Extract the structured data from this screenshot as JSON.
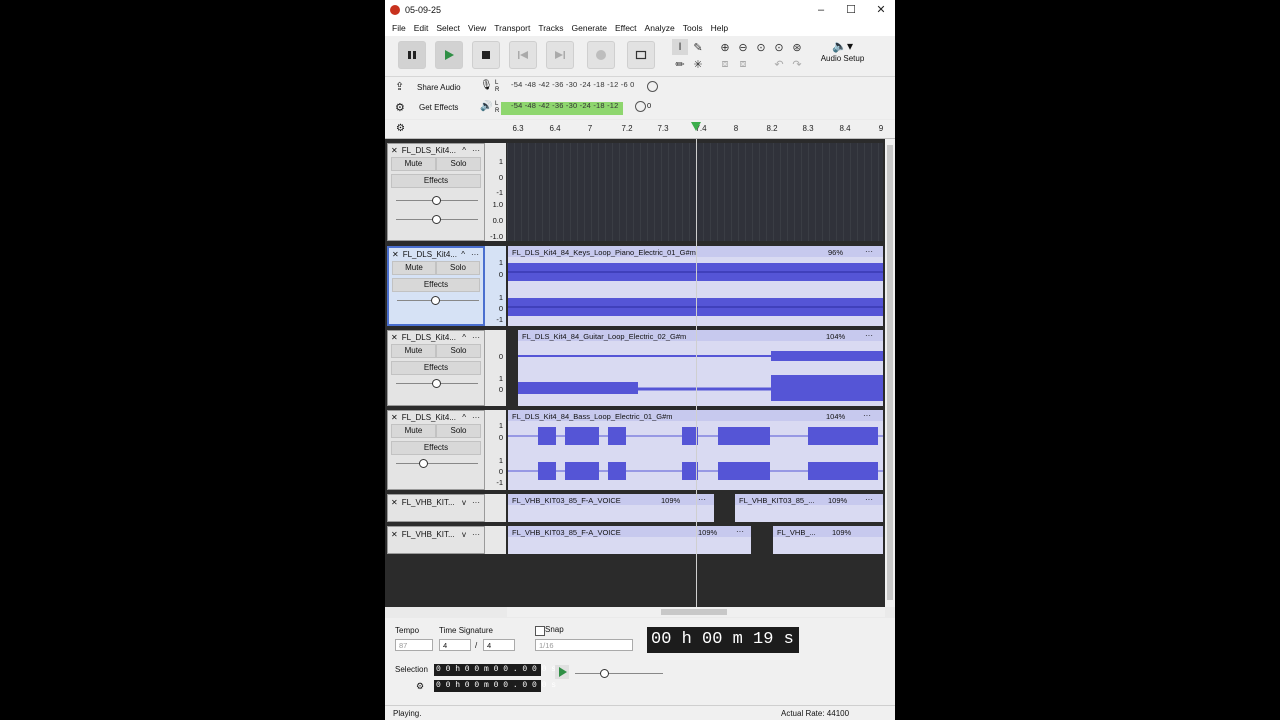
{
  "window": {
    "title": "05-09-25"
  },
  "menu": [
    "File",
    "Edit",
    "Select",
    "View",
    "Transport",
    "Tracks",
    "Generate",
    "Effect",
    "Analyze",
    "Tools",
    "Help"
  ],
  "toolbar": {
    "audio_setup_label": "Audio Setup"
  },
  "share_audio_label": "Share Audio",
  "get_effects_label": "Get Effects",
  "meters": {
    "record_ticks": "-54 -48 -42 -36 -30 -24 -18 -12  -6   0",
    "play_ticks": "-54 -48 -42 -36 -30 -24 -18 -12",
    "play_tail": "0",
    "record_lr": "L R",
    "play_lr": "L R"
  },
  "ruler": {
    "ticks": [
      "6.3",
      "6.4",
      "7",
      "7.2",
      "7.3",
      "7.4",
      "8",
      "8.2",
      "8.3",
      "8.4",
      "9"
    ]
  },
  "tracks": [
    {
      "name": "FL_DLS_Kit4...",
      "mute": "Mute",
      "solo": "Solo",
      "effects": "Effects",
      "scale_top": [
        "1",
        "0",
        "-1"
      ],
      "scale_bottom": [
        "1.0",
        "0.0",
        "-1.0"
      ]
    },
    {
      "name": "FL_DLS_Kit4...",
      "mute": "Mute",
      "solo": "Solo",
      "effects": "Effects",
      "clip": "FL_DLS_Kit4_84_Keys_Loop_Piano_Electric_01_G#m",
      "pct": "96%",
      "scale_top": [
        "1",
        "0"
      ],
      "scale_bottom": [
        "1",
        "0",
        "-1"
      ]
    },
    {
      "name": "FL_DLS_Kit4...",
      "mute": "Mute",
      "solo": "Solo",
      "effects": "Effects",
      "clip": "FL_DLS_Kit4_84_Guitar_Loop_Electric_02_G#m",
      "pct": "104%",
      "scale_top": [
        "0"
      ],
      "scale_bottom": [
        "1",
        "0"
      ]
    },
    {
      "name": "FL_DLS_Kit4...",
      "mute": "Mute",
      "solo": "Solo",
      "effects": "Effects",
      "clip": "FL_DLS_Kit4_84_Bass_Loop_Electric_01_G#m",
      "pct": "104%",
      "scale_top": [
        "1",
        "0"
      ],
      "scale_bottom": [
        "1",
        "0",
        "-1"
      ]
    },
    {
      "name": "FL_VHB_KIT...",
      "clip_a": "FL_VHB_KIT03_85_F-A_VOICE",
      "pct_a": "109%",
      "clip_b": "FL_VHB_KIT03_85_...",
      "pct_b": "109%"
    },
    {
      "name": "FL_VHB_KIT...",
      "clip_a": "FL_VHB_KIT03_85_F-A_VOICE",
      "pct_a": "109%",
      "clip_b": "FL_VHB_...",
      "pct_b": "109%"
    }
  ],
  "tempo": {
    "label": "Tempo",
    "value": "87"
  },
  "time_signature": {
    "label": "Time Signature",
    "num": "4",
    "den": "4",
    "sep": "/"
  },
  "snap": {
    "label": "Snap",
    "value": "1/16"
  },
  "big_time": "00 h 00 m 19 s",
  "selection": {
    "label": "Selection",
    "start": "0 0 h 0 0 m 0 0 . 0 0 0 s",
    "end": "0 0 h 0 0 m 0 0 . 0 0 0 s"
  },
  "status": {
    "left": "Playing.",
    "right": "Actual Rate: 44100"
  },
  "colors": {
    "waveform": "#5555d6",
    "clip_bg": "#d9daf2",
    "track_bg": "#2b2b2b",
    "meter_green": "#8ed66e"
  }
}
